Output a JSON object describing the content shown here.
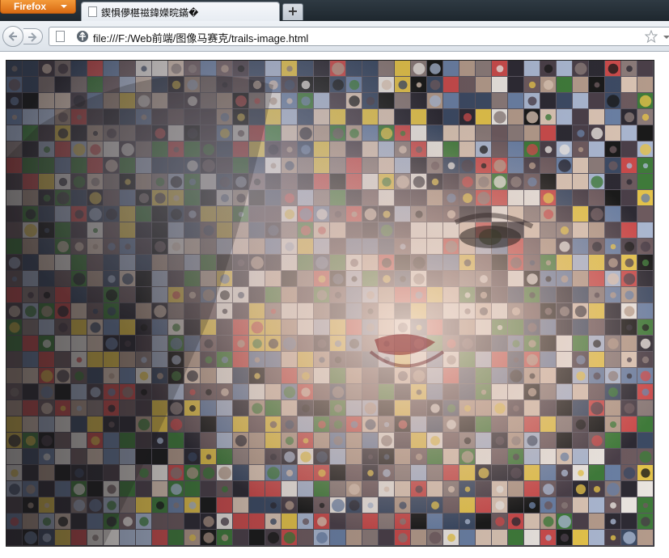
{
  "browser": {
    "menu_button_label": "Firefox",
    "tabs": [
      {
        "title": "鍥惧儚椹禌鍏嬫晥鏋�"
      }
    ],
    "new_tab_label": "+"
  },
  "navigation": {
    "url": "file:///F:/Web前端/图像马赛克/trails-image.html"
  },
  "content": {
    "image_description_name": "photo-mosaic",
    "colors": {
      "tile_palette": [
        "#2d2a33",
        "#4a3f48",
        "#6d5a5e",
        "#8a7a78",
        "#b39a8a",
        "#d8c2b2",
        "#3c4a63",
        "#6a7fa3",
        "#a9b6cf",
        "#c94b4b",
        "#e3c24a",
        "#3f7a3a",
        "#1a1a1a",
        "#e9e4df"
      ],
      "portrait_skin": "#f1d6c6",
      "portrait_hair": "#1f1a1c",
      "lips": "#8e2b2e"
    }
  }
}
